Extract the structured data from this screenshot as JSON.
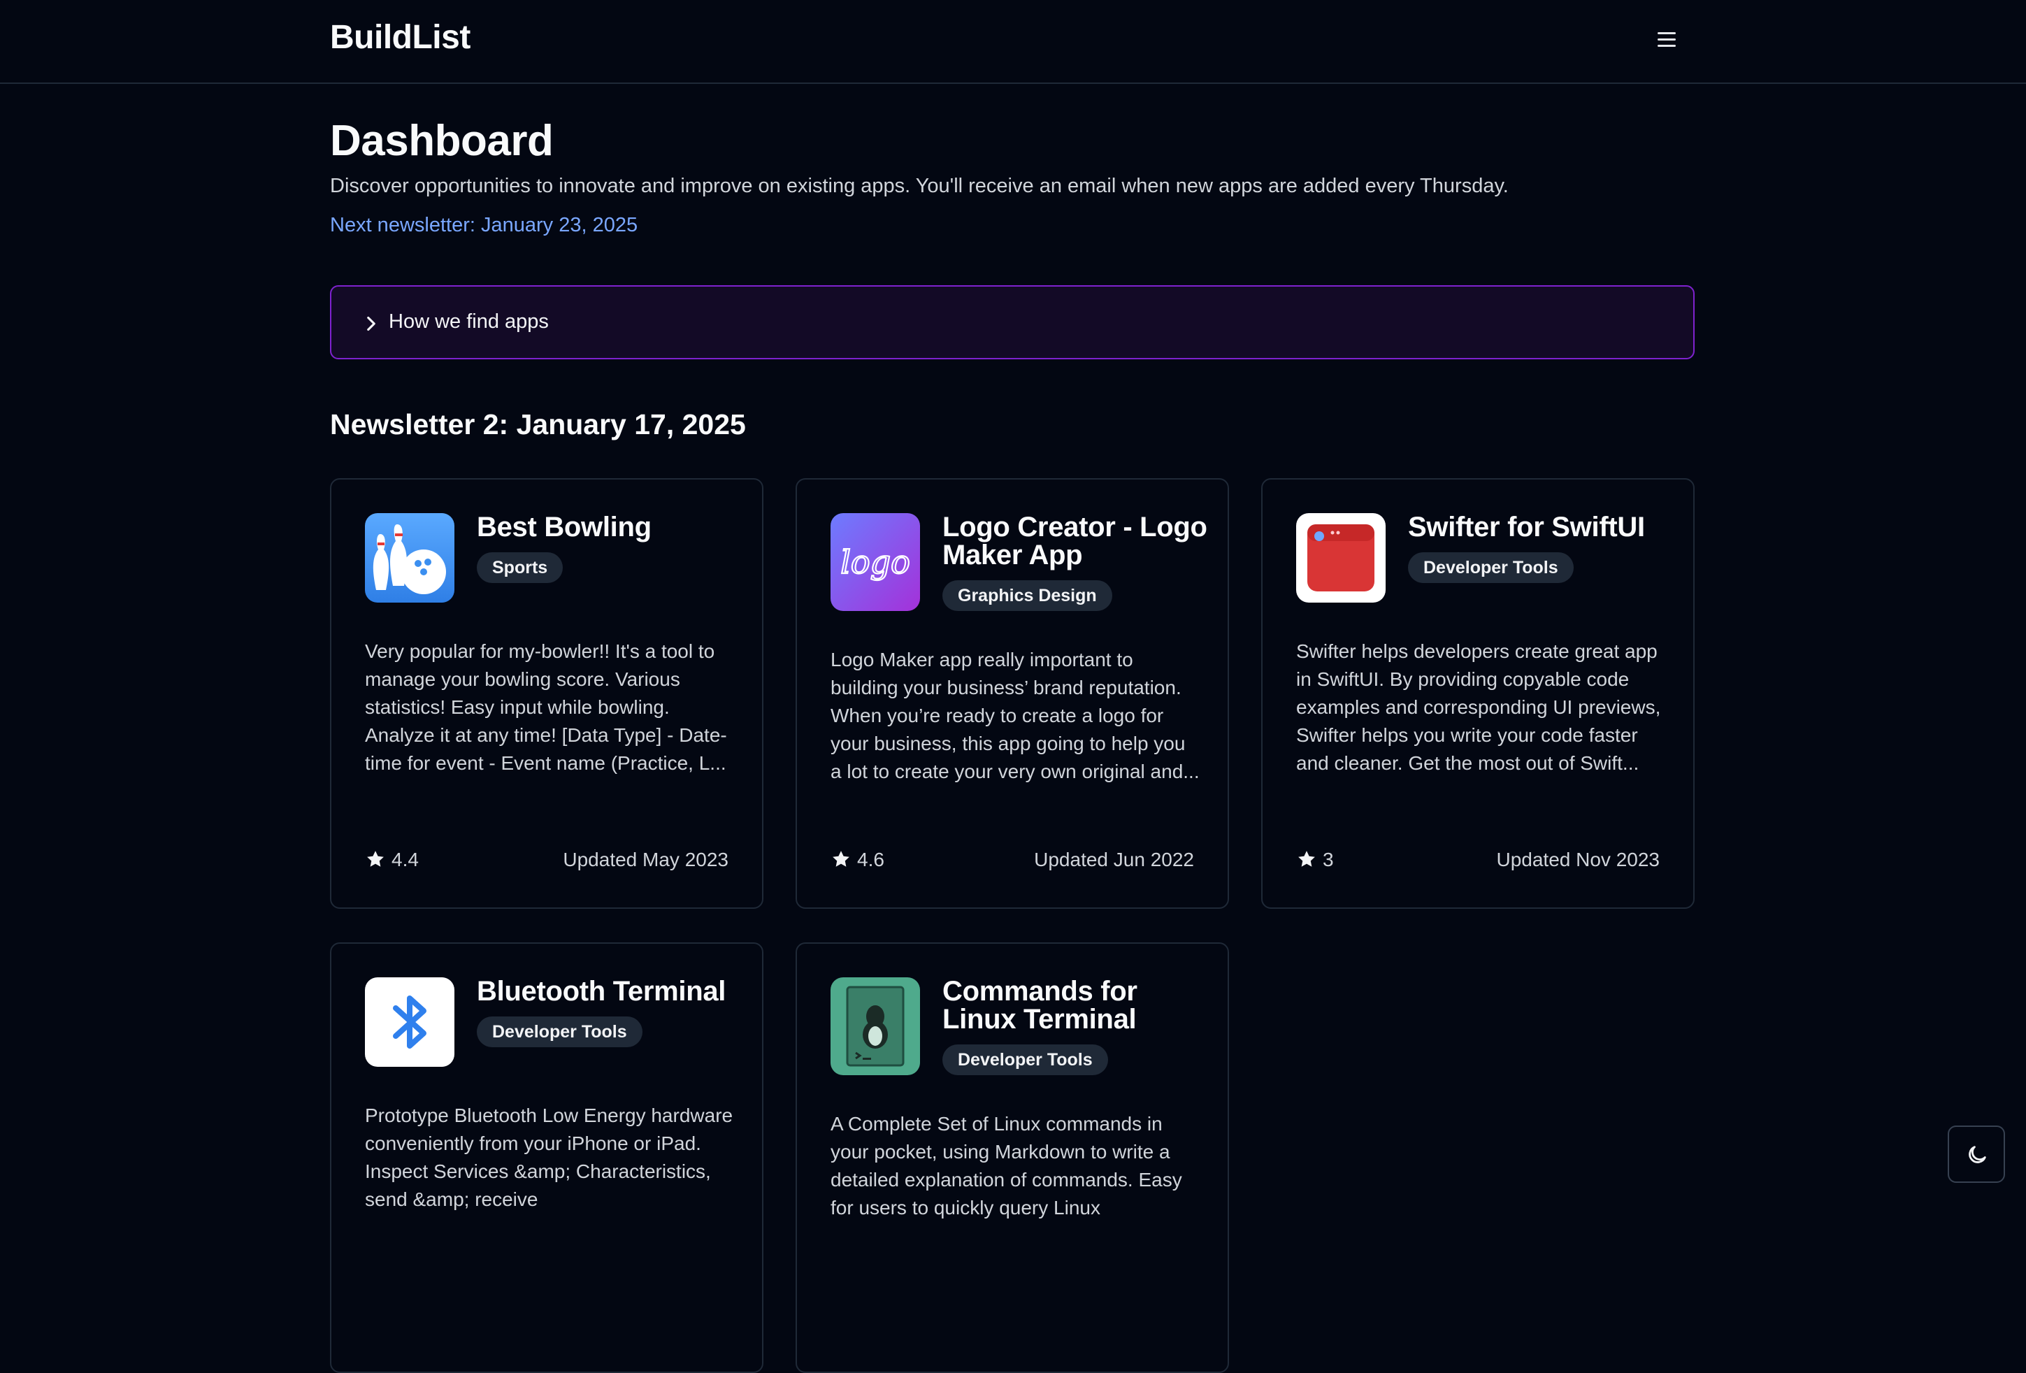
{
  "header": {
    "brand": "BuildList"
  },
  "page": {
    "title": "Dashboard",
    "subtitle": "Discover opportunities to innovate and improve on existing apps. You'll receive an email when new apps are added every Thursday.",
    "next_newsletter": "Next newsletter: January 23, 2025"
  },
  "accordion": {
    "label": "How we find apps"
  },
  "newsletter": {
    "title": "Newsletter 2: January 17, 2025",
    "apps": [
      {
        "name": "Best Bowling",
        "category": "Sports",
        "description": "Very popular for my-bowler!! It's a tool to manage your bowling score. Various statistics! Easy input while bowling. Analyze it at any time! [Data Type] - Date-time for event - Event name (Practice, L...",
        "rating": "4.4",
        "updated": "Updated May 2023",
        "icon": "bowling-icon"
      },
      {
        "name": "Logo Creator - Logo Maker App",
        "category": "Graphics Design",
        "description": "Logo Maker app really important to building your business’ brand reputation. When you’re ready to create a logo for your business, this app going to help you a lot to create your very own original and...",
        "rating": "4.6",
        "updated": "Updated Jun 2022",
        "icon": "logo-maker-icon",
        "icon_text": "logo"
      },
      {
        "name": "Swifter for SwiftUI",
        "category": "Developer Tools",
        "description": "Swifter helps developers create great app in SwiftUI. By providing copyable code examples and corresponding UI previews, Swifter helps you write your code faster and cleaner. Get the most out of Swift...",
        "rating": "3",
        "updated": "Updated Nov 2023",
        "icon": "swifter-window-icon"
      },
      {
        "name": "Bluetooth Terminal",
        "category": "Developer Tools",
        "description": "Prototype Bluetooth Low Energy hardware conveniently from your iPhone or iPad. Inspect Services &amp; Characteristics, send &amp; receive",
        "icon": "bluetooth-icon"
      },
      {
        "name": "Commands for Linux Terminal",
        "category": "Developer Tools",
        "description": "A Complete Set of Linux commands in your pocket, using Markdown to write a detailed explanation of commands. Easy for users to quickly query Linux",
        "icon": "linux-terminal-icon"
      }
    ]
  },
  "colors": {
    "background": "#030712",
    "accent_link": "#7aa7ff",
    "accordion_border": "#7e22ce",
    "tag_bg": "#1f2937"
  },
  "icons": {
    "menu": "hamburger-menu-icon",
    "accordion": "chevron-right-icon",
    "rating": "star-icon",
    "theme": "moon-icon"
  }
}
